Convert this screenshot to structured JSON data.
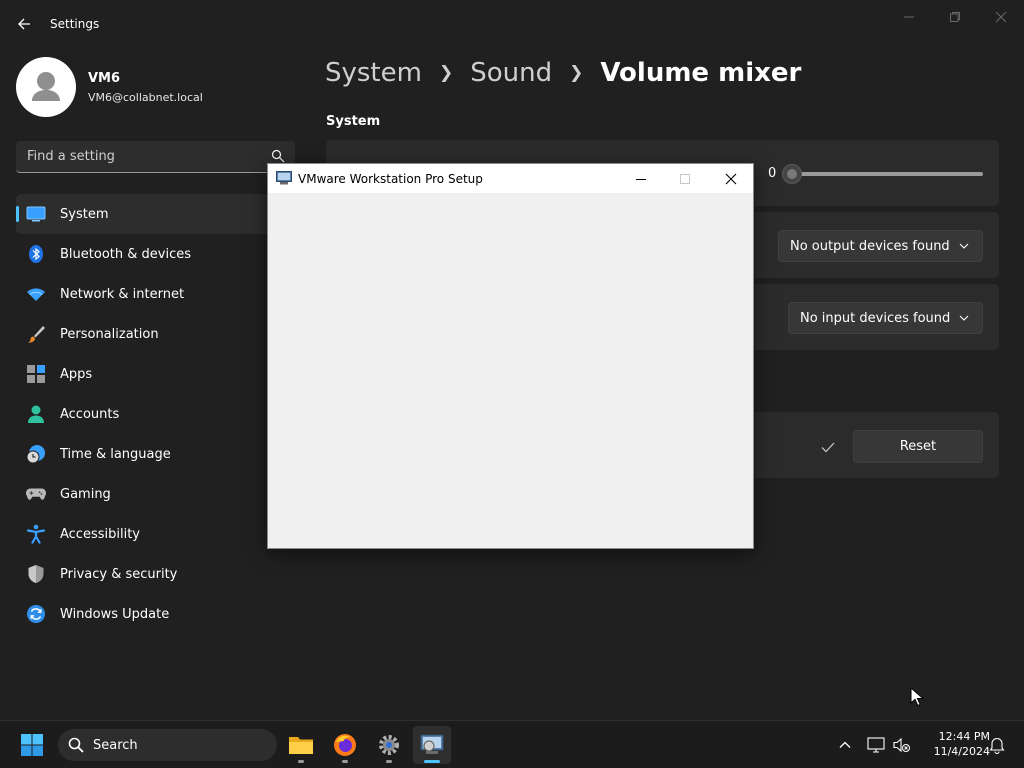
{
  "window": {
    "app_title": "Settings"
  },
  "profile": {
    "name": "VM6",
    "email": "VM6@collabnet.local"
  },
  "search": {
    "placeholder": "Find a setting"
  },
  "nav": {
    "items": [
      {
        "label": "System",
        "icon": "monitor-icon",
        "active": true
      },
      {
        "label": "Bluetooth & devices",
        "icon": "bluetooth-icon"
      },
      {
        "label": "Network & internet",
        "icon": "wifi-icon"
      },
      {
        "label": "Personalization",
        "icon": "brush-icon"
      },
      {
        "label": "Apps",
        "icon": "apps-icon"
      },
      {
        "label": "Accounts",
        "icon": "person-icon"
      },
      {
        "label": "Time & language",
        "icon": "clock-globe-icon"
      },
      {
        "label": "Gaming",
        "icon": "gamepad-icon"
      },
      {
        "label": "Accessibility",
        "icon": "accessibility-icon"
      },
      {
        "label": "Privacy & security",
        "icon": "shield-icon"
      },
      {
        "label": "Windows Update",
        "icon": "update-icon"
      }
    ]
  },
  "breadcrumb": {
    "parts": [
      "System",
      "Sound"
    ],
    "current": "Volume mixer"
  },
  "main": {
    "section_title": "System",
    "volume_value": "0",
    "output_dropdown": "No output devices found",
    "input_dropdown": "No input devices found",
    "reset_label": "Reset"
  },
  "dialog": {
    "title": "VMware Workstation Pro Setup"
  },
  "taskbar": {
    "search_label": "Search",
    "time": "12:44 PM",
    "date": "11/4/2024"
  },
  "colors": {
    "accent": "#4cc2ff",
    "background": "#202020",
    "card": "#2b2b2b"
  }
}
